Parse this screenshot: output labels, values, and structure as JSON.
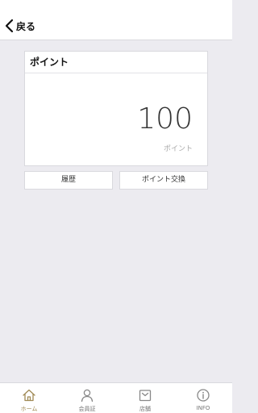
{
  "header": {
    "back_label": "戻る"
  },
  "points_card": {
    "title": "ポイント",
    "value": "100",
    "unit": "ポイント"
  },
  "buttons": {
    "history": "履歴",
    "exchange": "ポイント交換"
  },
  "tabbar": {
    "items": [
      {
        "label": "ホーム",
        "icon": "home-icon",
        "active": true
      },
      {
        "label": "会員証",
        "icon": "person-icon",
        "active": false
      },
      {
        "label": "店舗",
        "icon": "store-icon",
        "active": false
      },
      {
        "label": "INFO",
        "icon": "info-icon",
        "active": false
      }
    ]
  },
  "colors": {
    "accent": "#a08a55",
    "background": "#ecebf0"
  }
}
